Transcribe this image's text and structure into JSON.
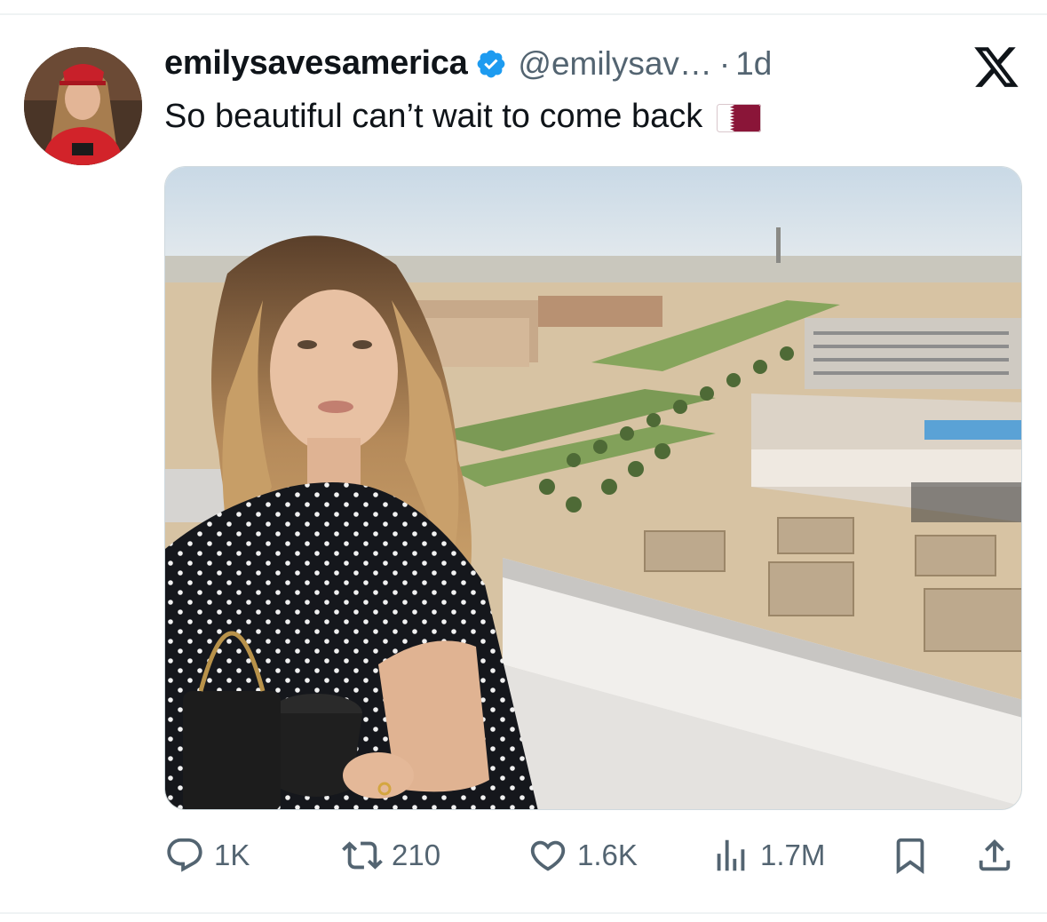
{
  "post": {
    "display_name": "emilysavesamerica",
    "handle": "@emilysav…",
    "separator": "·",
    "time": "1d",
    "text": "So beautiful can’t wait to come back",
    "verified": true,
    "flag_icon": "qatar-flag-icon",
    "media_subject": "selfie-on-rooftop-campus-view"
  },
  "actions": {
    "replies": "1K",
    "reposts": "210",
    "likes": "1.6K",
    "views": "1.7M"
  },
  "colors": {
    "verified_blue": "#1d9bf0",
    "secondary_text": "#536471",
    "primary_text": "#0f1419",
    "flag_maroon": "#8a1538"
  }
}
